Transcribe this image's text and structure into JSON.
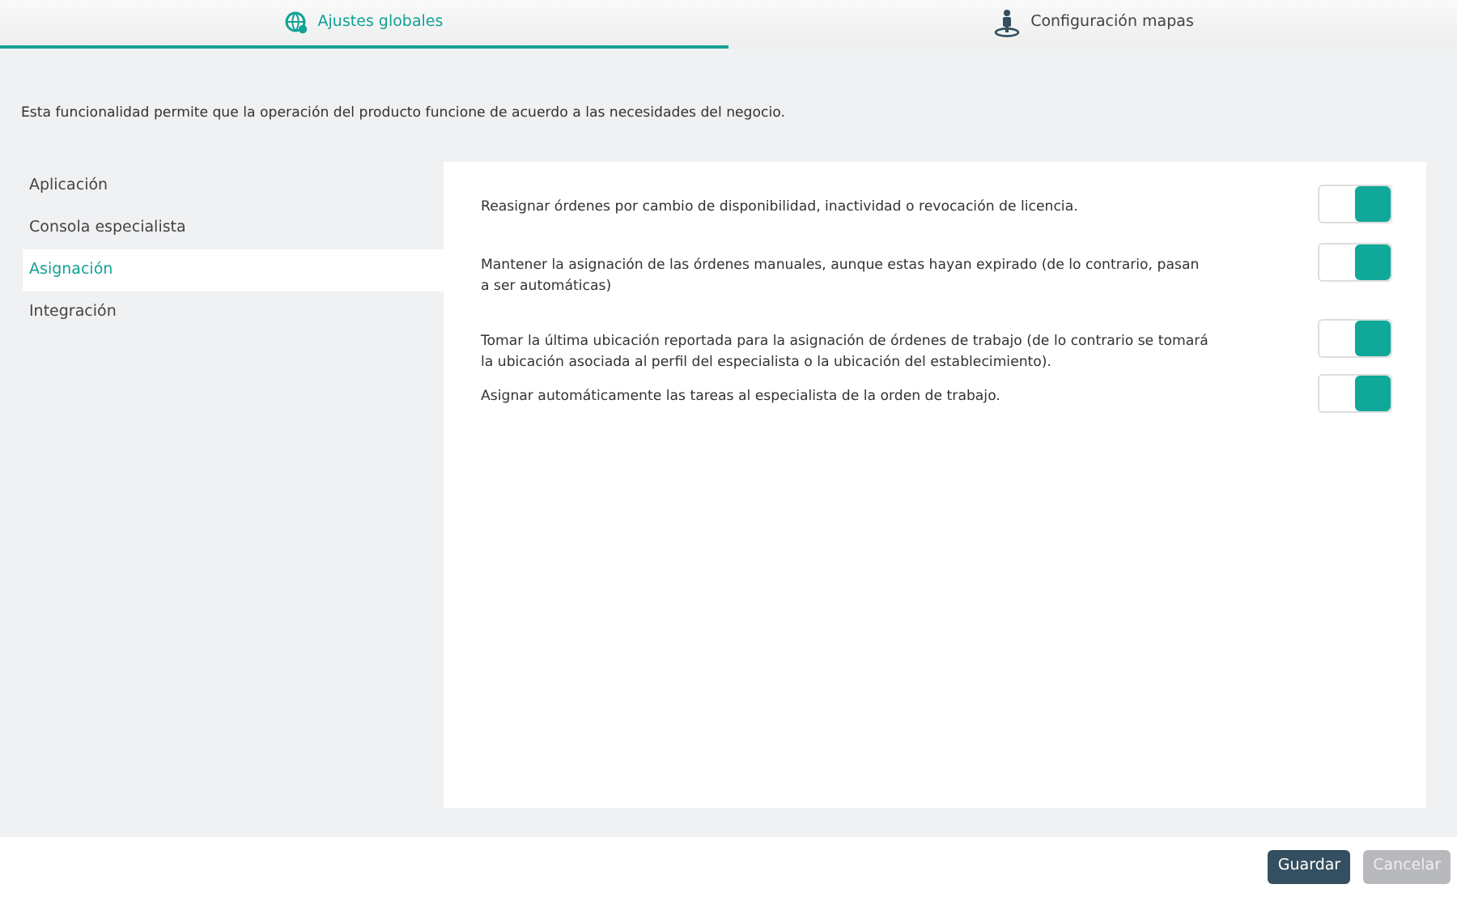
{
  "tabs": [
    {
      "label": "Ajustes globales",
      "selected": true
    },
    {
      "label": "Configuración mapas",
      "selected": false
    }
  ],
  "description": "Esta funcionalidad permite que la operación del producto funcione de acuerdo a las necesidades del negocio.",
  "sidebar": {
    "items": [
      {
        "label": "Aplicación",
        "selected": false
      },
      {
        "label": "Consola especialista",
        "selected": false
      },
      {
        "label": "Asignación",
        "selected": true
      },
      {
        "label": "Integración",
        "selected": false
      }
    ]
  },
  "settings": [
    {
      "label": "Reasignar órdenes por cambio de disponibilidad, inactividad o revocación de licencia.",
      "on": true
    },
    {
      "label": "Mantener la asignación de las órdenes manuales, aunque estas hayan expirado (de lo contrario, pasan a ser automáticas)",
      "on": true
    },
    {
      "label": "Tomar la última ubicación reportada para la asignación de órdenes de trabajo (de lo contrario se tomará la ubicación asociada al perfil del especialista o la ubicación del establecimiento).",
      "on": true
    },
    {
      "label": "Asignar automáticamente las tareas al especialista de la orden de trabajo.",
      "on": true
    }
  ],
  "buttons": [
    {
      "label": "Guardar",
      "kind": "primary",
      "disabled": false
    },
    {
      "label": "Cancelar",
      "kind": "secondary",
      "disabled": true
    }
  ]
}
